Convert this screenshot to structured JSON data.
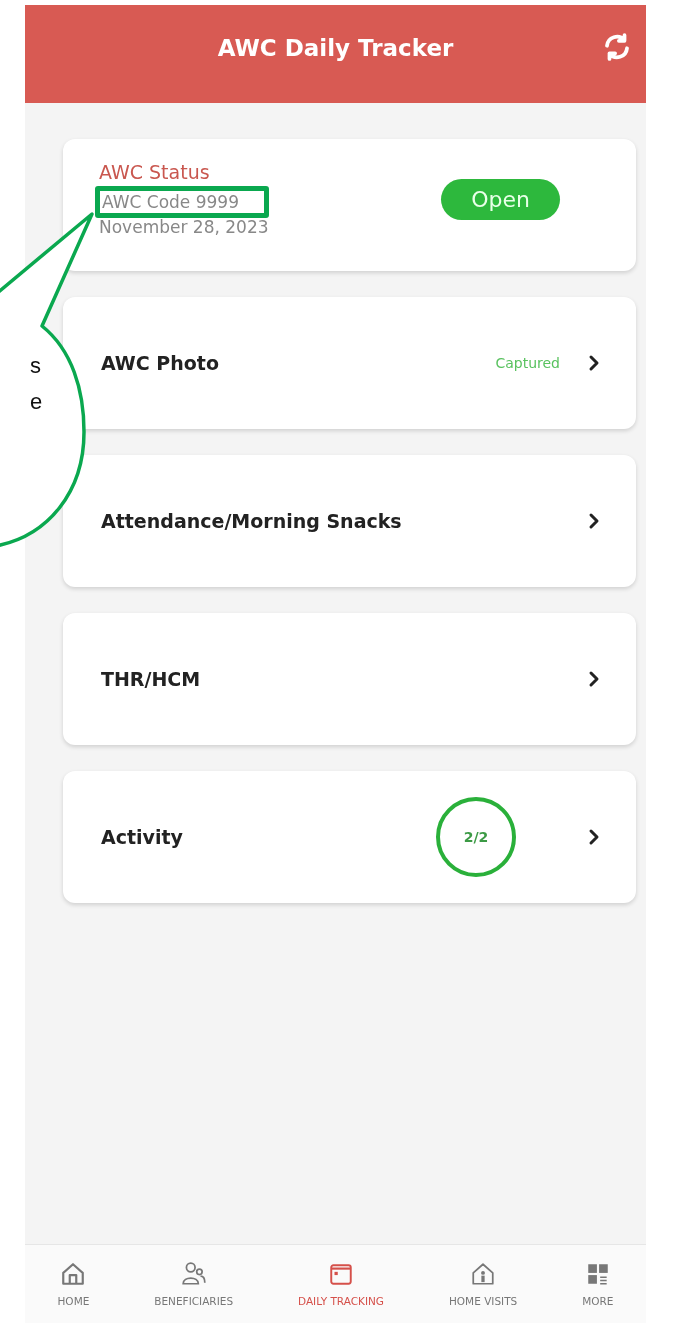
{
  "header": {
    "title": "AWC Daily Tracker"
  },
  "status_card": {
    "title": "AWC Status",
    "code": "AWC Code 9999",
    "date": "November 28, 2023",
    "status": "Open",
    "highlight_code": true
  },
  "items": [
    {
      "label": "AWC Photo",
      "kind": "status",
      "status": "Captured"
    },
    {
      "label": "Attendance/Morning Snacks",
      "kind": "plain"
    },
    {
      "label": "THR/HCM",
      "kind": "plain"
    },
    {
      "label": "Activity",
      "kind": "counter",
      "count": "2/2"
    }
  ],
  "callout": {
    "lines": [
      "s",
      "e"
    ]
  },
  "nav": [
    {
      "label": "HOME",
      "selected": false
    },
    {
      "label": "BENEFICIARIES",
      "selected": false
    },
    {
      "label": "DAILY TRACKING",
      "selected": true
    },
    {
      "label": "HOME VISITS",
      "selected": false
    },
    {
      "label": "MORE",
      "selected": false
    }
  ]
}
